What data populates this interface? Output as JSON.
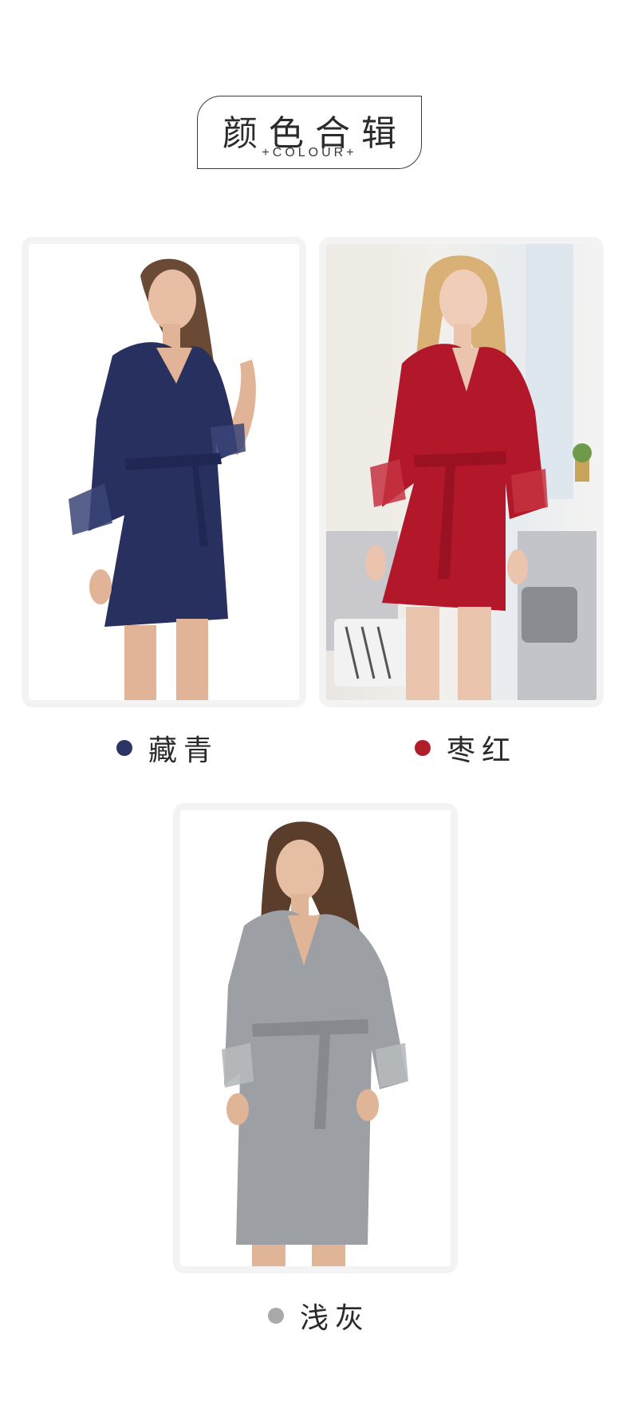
{
  "header": {
    "title_cn": "颜色合辑",
    "title_en": "+COLOUR+"
  },
  "colors": [
    {
      "label": "藏青",
      "swatch": "#2b3463",
      "garment": "#27305f",
      "icon": "navy-robe-photo"
    },
    {
      "label": "枣红",
      "swatch": "#b11d2a",
      "garment": "#b2172a",
      "icon": "red-robe-photo"
    },
    {
      "label": "浅灰",
      "swatch": "#a9a9a9",
      "garment": "#9c9fa3",
      "icon": "grey-robe-photo"
    }
  ]
}
